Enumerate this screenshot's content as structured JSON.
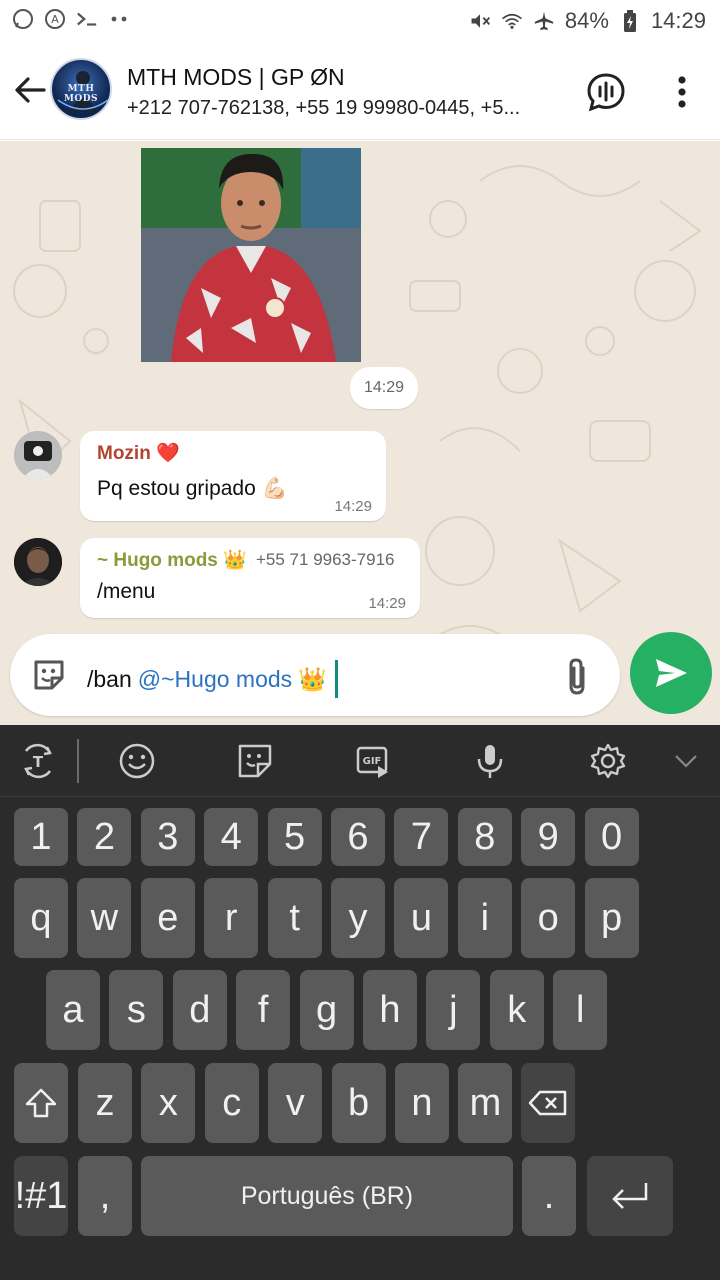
{
  "status_bar": {
    "battery": "84%",
    "time": "14:29"
  },
  "header": {
    "avatar_text": "MTH MODS",
    "title": "MTH MODS | GP ØN",
    "subtitle": "+212 707-762138, +55 19 99980-0445, +5..."
  },
  "chat": {
    "sticker_time": "14:29",
    "messages": [
      {
        "sender": "Mozin",
        "sender_emoji": "❤️",
        "sender_color": "#b5442f",
        "text": "Pq estou gripado",
        "text_emoji": "💪🏻",
        "time": "14:29"
      },
      {
        "sender": "~ Hugo mods",
        "sender_emoji": "👑",
        "sender_color": "#8b9a3a",
        "phone": "+55 71 9963-7916",
        "text": "/menu",
        "time": "14:29"
      }
    ]
  },
  "composer": {
    "prefix": "/ban",
    "mention": "@~Hugo mods",
    "emoji": "👑"
  },
  "keyboard": {
    "number_row": [
      "1",
      "2",
      "3",
      "4",
      "5",
      "6",
      "7",
      "8",
      "9",
      "0"
    ],
    "row1": [
      "q",
      "w",
      "e",
      "r",
      "t",
      "y",
      "u",
      "i",
      "o",
      "p"
    ],
    "row2": [
      "a",
      "s",
      "d",
      "f",
      "g",
      "h",
      "j",
      "k",
      "l"
    ],
    "row3": [
      "z",
      "x",
      "c",
      "v",
      "b",
      "n",
      "m"
    ],
    "symbols_label": "!#1",
    "comma": ",",
    "space_label": "Português (BR)",
    "period": "."
  },
  "colors": {
    "accent": "#25b064",
    "wallpaper": "#efe7dc",
    "keyboard_bg": "#2b2b2b",
    "key_bg": "#5a5a5a"
  }
}
